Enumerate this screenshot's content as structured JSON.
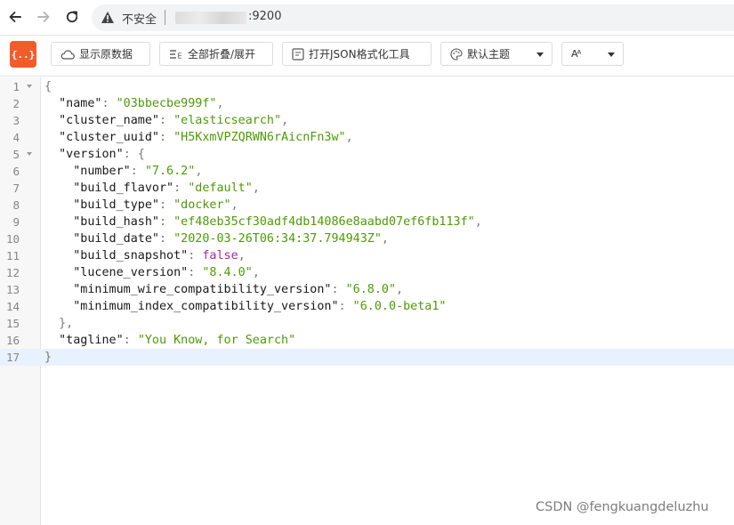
{
  "browser": {
    "security_label": "不安全",
    "url_suffix": ":9200",
    "icons": [
      "back-icon",
      "forward-icon",
      "reload-icon",
      "warning-icon"
    ]
  },
  "toolbar": {
    "logo_label": "{..}",
    "raw_label": "显示原数据",
    "fold_label": "全部折叠/展开",
    "format_label": "打开JSON格式化工具",
    "theme_label": "默认主题",
    "font_label": "Aᴬ"
  },
  "json_lines": [
    {
      "n": "1",
      "parts": [
        [
          "p",
          "{"
        ]
      ]
    },
    {
      "n": "2",
      "parts": [
        [
          "t",
          "  "
        ],
        [
          "k",
          "\"name\""
        ],
        [
          "p",
          ": "
        ],
        [
          "s",
          "\"03bbecbe999f\""
        ],
        [
          "p",
          ","
        ]
      ]
    },
    {
      "n": "3",
      "parts": [
        [
          "t",
          "  "
        ],
        [
          "k",
          "\"cluster_name\""
        ],
        [
          "p",
          ": "
        ],
        [
          "s",
          "\"elasticsearch\""
        ],
        [
          "p",
          ","
        ]
      ]
    },
    {
      "n": "4",
      "parts": [
        [
          "t",
          "  "
        ],
        [
          "k",
          "\"cluster_uuid\""
        ],
        [
          "p",
          ": "
        ],
        [
          "s",
          "\"H5KxmVPZQRWN6rAicnFn3w\""
        ],
        [
          "p",
          ","
        ]
      ]
    },
    {
      "n": "5",
      "parts": [
        [
          "t",
          "  "
        ],
        [
          "k",
          "\"version\""
        ],
        [
          "p",
          ": {"
        ]
      ]
    },
    {
      "n": "6",
      "parts": [
        [
          "t",
          "    "
        ],
        [
          "k",
          "\"number\""
        ],
        [
          "p",
          ": "
        ],
        [
          "s",
          "\"7.6.2\""
        ],
        [
          "p",
          ","
        ]
      ]
    },
    {
      "n": "7",
      "parts": [
        [
          "t",
          "    "
        ],
        [
          "k",
          "\"build_flavor\""
        ],
        [
          "p",
          ": "
        ],
        [
          "s",
          "\"default\""
        ],
        [
          "p",
          ","
        ]
      ]
    },
    {
      "n": "8",
      "parts": [
        [
          "t",
          "    "
        ],
        [
          "k",
          "\"build_type\""
        ],
        [
          "p",
          ": "
        ],
        [
          "s",
          "\"docker\""
        ],
        [
          "p",
          ","
        ]
      ]
    },
    {
      "n": "9",
      "parts": [
        [
          "t",
          "    "
        ],
        [
          "k",
          "\"build_hash\""
        ],
        [
          "p",
          ": "
        ],
        [
          "s",
          "\"ef48eb35cf30adf4db14086e8aabd07ef6fb113f\""
        ],
        [
          "p",
          ","
        ]
      ]
    },
    {
      "n": "10",
      "parts": [
        [
          "t",
          "    "
        ],
        [
          "k",
          "\"build_date\""
        ],
        [
          "p",
          ": "
        ],
        [
          "s",
          "\"2020-03-26T06:34:37.794943Z\""
        ],
        [
          "p",
          ","
        ]
      ]
    },
    {
      "n": "11",
      "parts": [
        [
          "t",
          "    "
        ],
        [
          "k",
          "\"build_snapshot\""
        ],
        [
          "p",
          ": "
        ],
        [
          "b",
          "false"
        ],
        [
          "p",
          ","
        ]
      ]
    },
    {
      "n": "12",
      "parts": [
        [
          "t",
          "    "
        ],
        [
          "k",
          "\"lucene_version\""
        ],
        [
          "p",
          ": "
        ],
        [
          "s",
          "\"8.4.0\""
        ],
        [
          "p",
          ","
        ]
      ]
    },
    {
      "n": "13",
      "parts": [
        [
          "t",
          "    "
        ],
        [
          "k",
          "\"minimum_wire_compatibility_version\""
        ],
        [
          "p",
          ": "
        ],
        [
          "s",
          "\"6.8.0\""
        ],
        [
          "p",
          ","
        ]
      ]
    },
    {
      "n": "14",
      "parts": [
        [
          "t",
          "    "
        ],
        [
          "k",
          "\"minimum_index_compatibility_version\""
        ],
        [
          "p",
          ": "
        ],
        [
          "s",
          "\"6.0.0-beta1\""
        ]
      ]
    },
    {
      "n": "15",
      "parts": [
        [
          "t",
          "  "
        ],
        [
          "p",
          "},"
        ]
      ]
    },
    {
      "n": "16",
      "parts": [
        [
          "t",
          "  "
        ],
        [
          "k",
          "\"tagline\""
        ],
        [
          "p",
          ": "
        ],
        [
          "s",
          "\"You Know, for Search\""
        ]
      ]
    },
    {
      "n": "17",
      "parts": [
        [
          "p",
          "}"
        ]
      ]
    }
  ],
  "folded_lines": [
    "1",
    "5"
  ],
  "active_line": "17",
  "watermark": "CSDN @fengkuangdeluzhu"
}
